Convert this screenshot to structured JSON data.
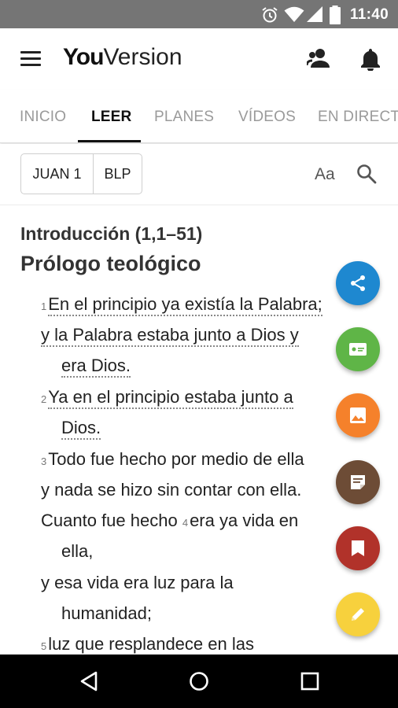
{
  "status_bar": {
    "time": "11:40",
    "icons": [
      "alarm-icon",
      "wifi-icon",
      "cell-signal-icon",
      "battery-icon"
    ]
  },
  "app_bar": {
    "logo_you": "You",
    "logo_version": "Version",
    "icons": [
      "menu-icon",
      "friends-icon",
      "notifications-icon"
    ]
  },
  "tabs": [
    {
      "label": "INICIO",
      "active": false
    },
    {
      "label": "LEER",
      "active": true
    },
    {
      "label": "PLANES",
      "active": false
    },
    {
      "label": "VÍDEOS",
      "active": false
    },
    {
      "label": "EN DIRECTO",
      "active": false
    }
  ],
  "reference": {
    "book_chapter": "JUAN 1",
    "version": "BLP",
    "font_size_label": "Aa"
  },
  "reader": {
    "intro_heading": "Introducción (1,1–51)",
    "section_title": "Prólogo teológico",
    "lines": [
      {
        "verse": "1",
        "text": "En el principio ya existía la Palabra;"
      },
      {
        "verse": "",
        "text": "y la Palabra estaba junto a Dios y"
      },
      {
        "verse": "",
        "text": "era Dios."
      },
      {
        "verse": "2",
        "text": "Ya en el principio estaba junto a"
      },
      {
        "verse": "",
        "text": "Dios."
      },
      {
        "verse": "3",
        "text": "Todo fue hecho por medio de ella"
      },
      {
        "verse": "",
        "text": "y nada se hizo sin contar con ella."
      },
      {
        "verse": "",
        "text": "Cuanto fue hecho"
      },
      {
        "verse": "4",
        "text": "era ya vida en"
      },
      {
        "verse": "",
        "text": "ella,"
      },
      {
        "verse": "",
        "text": "y esa vida era luz para la"
      },
      {
        "verse": "",
        "text": "humanidad;"
      },
      {
        "verse": "5",
        "text": "luz que resplandece en las"
      }
    ]
  },
  "fab_actions": [
    {
      "name": "share",
      "icon": "share-icon",
      "color": "#1e88d0"
    },
    {
      "name": "verse-card",
      "icon": "verse-card-icon",
      "color": "#5fb547"
    },
    {
      "name": "verse-image",
      "icon": "image-icon",
      "color": "#f5812b"
    },
    {
      "name": "note",
      "icon": "note-icon",
      "color": "#6d4c36"
    },
    {
      "name": "bookmark",
      "icon": "bookmark-icon",
      "color": "#b1322a"
    },
    {
      "name": "highlight",
      "icon": "pencil-icon",
      "color": "#f7d13d"
    }
  ],
  "nav_bar": {
    "icons": [
      "back-icon",
      "home-icon",
      "recents-icon"
    ]
  }
}
